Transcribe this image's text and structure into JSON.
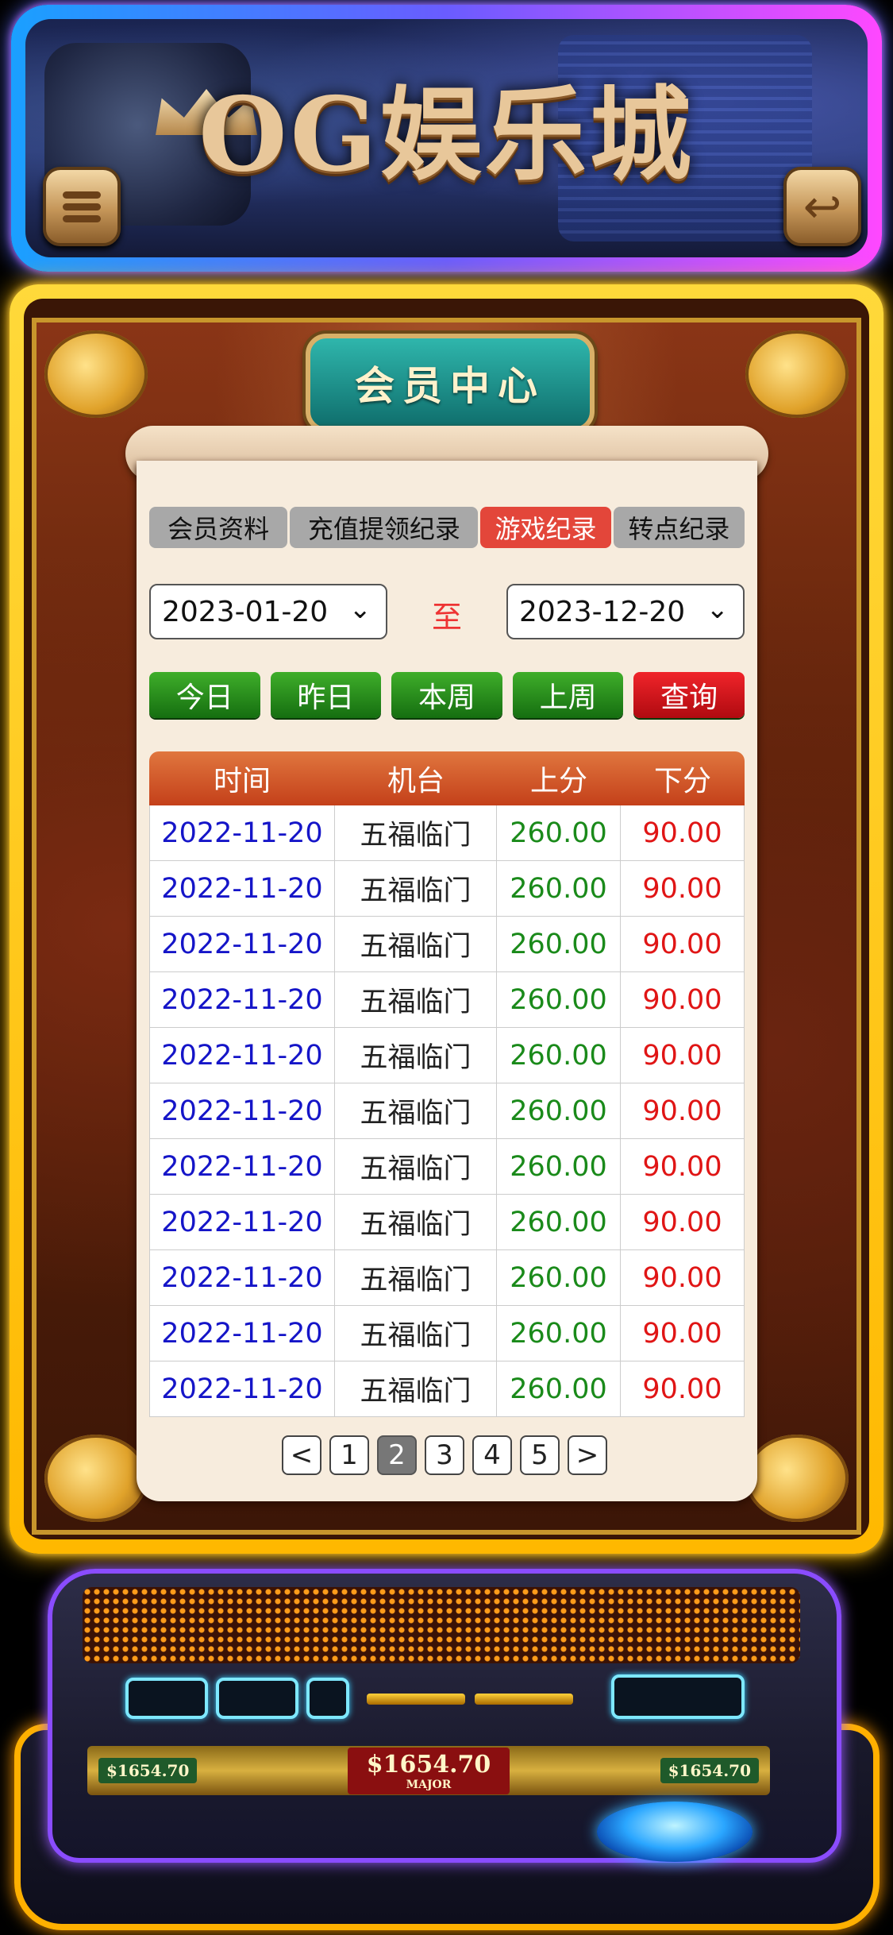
{
  "app": {
    "brand_mark": "OG",
    "brand_title": "OG娱乐城"
  },
  "header": {
    "menu_icon": "menu-icon",
    "back_icon": "back-arrow-icon"
  },
  "panel": {
    "title": "会员中心"
  },
  "tabs": [
    {
      "label": "会员资料",
      "active": false
    },
    {
      "label": "充值提领纪录",
      "active": false
    },
    {
      "label": "游戏纪录",
      "active": true
    },
    {
      "label": "转点纪录",
      "active": false
    }
  ],
  "date_filter": {
    "start": "2023-01-20",
    "separator": "至",
    "end": "2023-12-20"
  },
  "quick_buttons": [
    {
      "label": "今日"
    },
    {
      "label": "昨日"
    },
    {
      "label": "本周"
    },
    {
      "label": "上周"
    },
    {
      "label": "查询"
    }
  ],
  "table": {
    "headers": [
      "时间",
      "机台",
      "上分",
      "下分"
    ],
    "rows": [
      [
        "2022-11-20",
        "五福临门",
        "260.00",
        "90.00"
      ],
      [
        "2022-11-20",
        "五福临门",
        "260.00",
        "90.00"
      ],
      [
        "2022-11-20",
        "五福临门",
        "260.00",
        "90.00"
      ],
      [
        "2022-11-20",
        "五福临门",
        "260.00",
        "90.00"
      ],
      [
        "2022-11-20",
        "五福临门",
        "260.00",
        "90.00"
      ],
      [
        "2022-11-20",
        "五福临门",
        "260.00",
        "90.00"
      ],
      [
        "2022-11-20",
        "五福临门",
        "260.00",
        "90.00"
      ],
      [
        "2022-11-20",
        "五福临门",
        "260.00",
        "90.00"
      ],
      [
        "2022-11-20",
        "五福临门",
        "260.00",
        "90.00"
      ],
      [
        "2022-11-20",
        "五福临门",
        "260.00",
        "90.00"
      ],
      [
        "2022-11-20",
        "五福临门",
        "260.00",
        "90.00"
      ]
    ]
  },
  "pagination": {
    "prev": "<",
    "pages": [
      "1",
      "2",
      "3",
      "4",
      "5"
    ],
    "current": "2",
    "next": ">"
  },
  "machine": {
    "jackpot_left": "$1654.70",
    "jackpot_major": "$1654.70",
    "jackpot_major_label": "MAJOR",
    "jackpot_right": "$1654.70"
  },
  "colors": {
    "header_glow": "#6a5cff",
    "frame_glow": "#ffb800",
    "tab_active": "#e3463a",
    "tab_inactive": "#a8a8a8",
    "quick_button": "#2e8f1e",
    "query_button": "#d01218",
    "time_text": "#1515c8",
    "up_text": "#1a8a1a",
    "down_text": "#e01515"
  }
}
